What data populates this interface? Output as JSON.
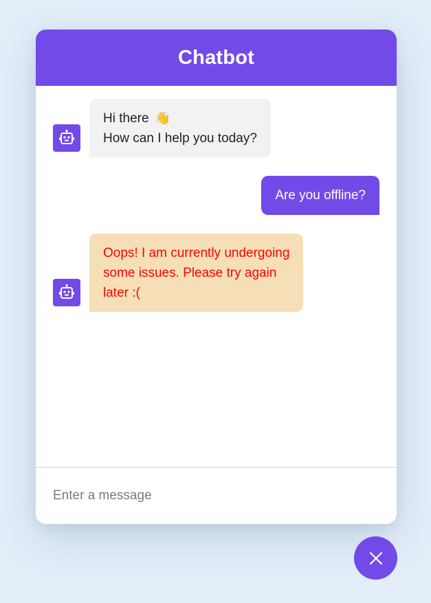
{
  "header": {
    "title": "Chatbot"
  },
  "messages": [
    {
      "role": "bot",
      "lines": [
        "Hi there",
        "How can I help you today?"
      ],
      "emoji": "👋",
      "avatar_icon": "robot-icon"
    },
    {
      "role": "user",
      "text": "Are you offline?"
    },
    {
      "role": "bot",
      "lines": [
        "Oops! I am currently undergoing",
        "some issues. Please try again",
        "later :("
      ],
      "status": "error",
      "avatar_icon": "robot-icon"
    }
  ],
  "input": {
    "placeholder": "Enter a message",
    "value": ""
  },
  "toggler": {
    "icon": "close-icon"
  },
  "colors": {
    "accent": "#724ae8",
    "background": "#e3eef9",
    "incoming_bubble": "#f2f2f2",
    "error_bubble": "#f6dfb6",
    "error_text": "#ff0000"
  }
}
